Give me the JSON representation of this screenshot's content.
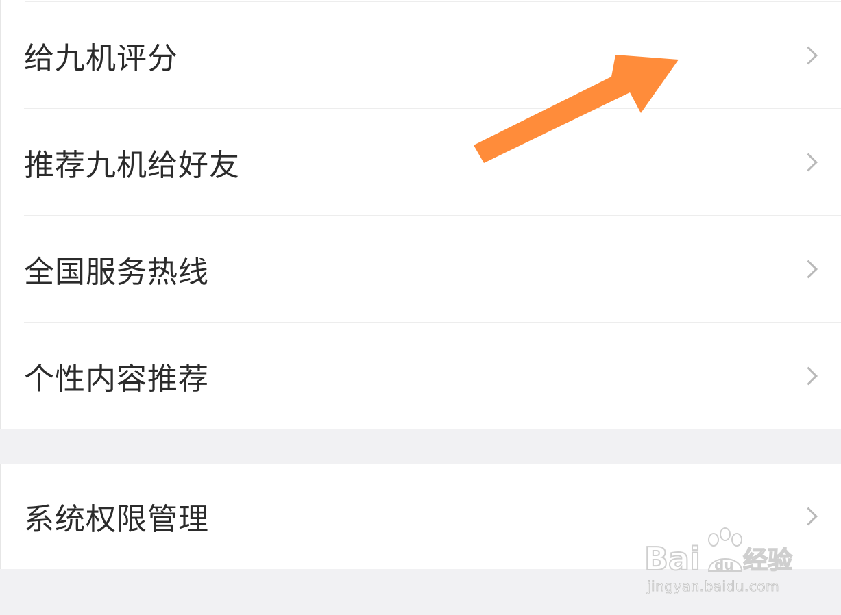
{
  "settings_list": {
    "group1": [
      {
        "label": "给九机评分"
      },
      {
        "label": "推荐九机给好友"
      },
      {
        "label": "全国服务热线"
      },
      {
        "label": "个性内容推荐"
      }
    ],
    "group2": [
      {
        "label": "系统权限管理"
      }
    ]
  },
  "annotation_arrow": {
    "color": "#ff8c3a"
  },
  "watermark": {
    "logo_text": "Bai",
    "logo_du": "du",
    "logo_cn": "经验",
    "url": "jingyan.baidu.com"
  },
  "colors": {
    "background": "#f1f1f3",
    "row_background": "#ffffff",
    "text": "#2b2b2b",
    "chevron": "#b9b9b9",
    "divider": "#ededed"
  }
}
